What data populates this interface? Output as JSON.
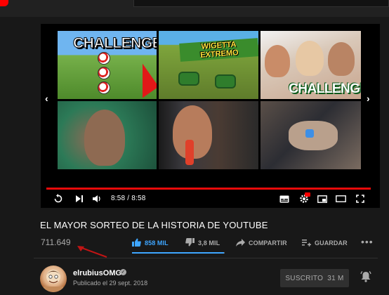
{
  "player": {
    "time_display": "8:58 / 8:58",
    "progress_fraction": 1.0,
    "progress_color": "#e80a0a",
    "endscreen": [
      {
        "text": "CHALLENGE"
      },
      {
        "text": "WIGETTA EXTREMO"
      },
      {
        "text": "CHALLENGE"
      },
      {
        "text": ""
      },
      {
        "text": ""
      },
      {
        "text": ""
      }
    ]
  },
  "video": {
    "title": "EL MAYOR SORTEO DE LA HISTORIA DE YOUTUBE",
    "views": "711.649",
    "like_ratio": 0.996
  },
  "actions": {
    "likes": "858 MIL",
    "dislikes": "3,8 MIL",
    "share": "COMPARTIR",
    "save": "GUARDAR"
  },
  "channel": {
    "name": "elrubiusOMG",
    "published": "Publicado el 29 sept. 2018",
    "subscribe_label": "SUSCRITO",
    "subscriber_count": "31 M"
  },
  "colors": {
    "accent_blue": "#3ea6ff",
    "brand_red": "#ff0000",
    "background": "#181818"
  },
  "icons": [
    "replay-icon",
    "next-icon",
    "volume-icon",
    "subtitles-icon",
    "settings-icon",
    "miniplayer-icon",
    "theater-icon",
    "fullscreen-icon",
    "thumbs-up-icon",
    "thumbs-down-icon",
    "share-icon",
    "playlist-add-icon",
    "more-icon",
    "bell-icon",
    "verified-icon"
  ]
}
